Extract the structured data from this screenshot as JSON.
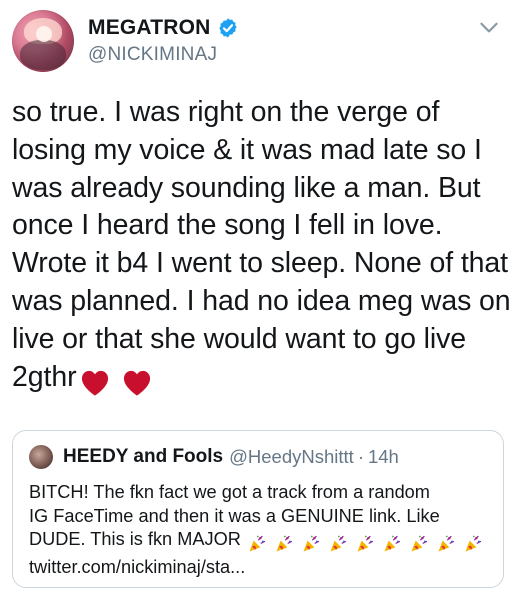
{
  "header": {
    "display_name": "MEGATRON",
    "handle": "@NICKIMINAJ",
    "verified": true,
    "icons": {
      "avatar": "profile-photo",
      "verified": "verified-badge-icon",
      "menu": "chevron-down-icon"
    }
  },
  "tweet": {
    "lines": [
      "so true. I was right on the verge of",
      "losing my voice & it was mad late so I",
      "was already sounding like a man. But",
      "once I heard the song I fell in love.",
      "Wrote it b4 I went to sleep. None of that",
      "was planned. I had no idea meg was on",
      "live or that she would want to go live",
      "2gthr"
    ],
    "emoji": [
      "red-heart",
      "red-heart"
    ]
  },
  "quoted_tweet": {
    "display_name": "HEEDY and Fools",
    "handle": "@HeedyNshittt",
    "separator": "·",
    "time": "14h",
    "lines": [
      "BITCH! The fkn fact we got a track from a random",
      "IG FaceTime and then it was a GENUINE link. Like",
      "DUDE. This is fkn MAJOR",
      "twitter.com/nickiminaj/sta..."
    ],
    "emoji": [
      "party-popper",
      "party-popper",
      "party-popper",
      "party-popper",
      "party-popper",
      "party-popper",
      "party-popper",
      "party-popper",
      "party-popper"
    ]
  },
  "colors": {
    "text": "#14171a",
    "secondary": "#657786",
    "verified": "#1da1f2",
    "heart": "#e0245e",
    "border": "#ccd6dd"
  }
}
